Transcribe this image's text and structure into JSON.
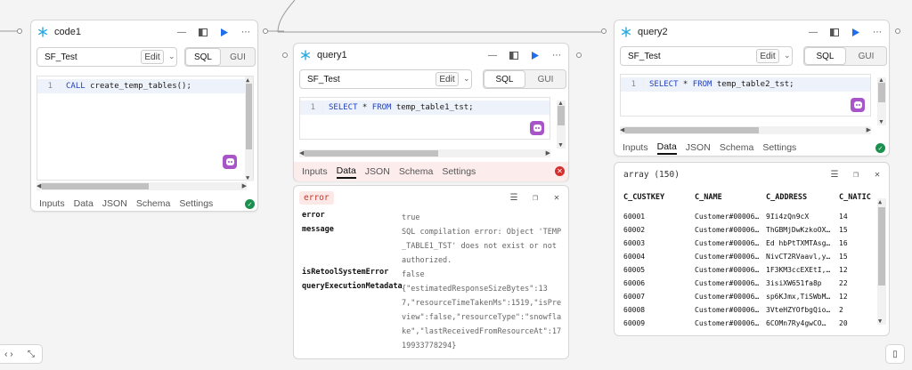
{
  "colors": {
    "accent": "#1f6feb",
    "success": "#1a8f4e",
    "error": "#d32f2f",
    "ai": "#a855c8",
    "errorBg": "#fde8e8"
  },
  "code1": {
    "title": "code1",
    "resource": "SF_Test",
    "edit_label": "Edit",
    "mode_sql": "SQL",
    "mode_gui": "GUI",
    "line_no": "1",
    "code_kw": "CALL",
    "code_rest": " create_temp_tables();",
    "tabs": [
      "Inputs",
      "Data",
      "JSON",
      "Schema",
      "Settings"
    ]
  },
  "query1": {
    "title": "query1",
    "resource": "SF_Test",
    "edit_label": "Edit",
    "mode_sql": "SQL",
    "mode_gui": "GUI",
    "line_no": "1",
    "code_kw1": "SELECT",
    "code_mid": " * ",
    "code_kw2": "FROM",
    "code_rest": " temp_table1_tst;",
    "tabs": [
      "Inputs",
      "Data",
      "JSON",
      "Schema",
      "Settings"
    ]
  },
  "query2": {
    "title": "query2",
    "resource": "SF_Test",
    "edit_label": "Edit",
    "mode_sql": "SQL",
    "mode_gui": "GUI",
    "line_no": "1",
    "code_kw1": "SELECT",
    "code_mid": " * ",
    "code_kw2": "FROM",
    "code_rest": " temp_table2_tst;",
    "tabs": [
      "Inputs",
      "Data",
      "JSON",
      "Schema",
      "Settings"
    ]
  },
  "error_result": {
    "badge": "error",
    "rows": [
      {
        "key": "error",
        "value": "true"
      },
      {
        "key": "message",
        "value": "SQL compilation error: Object 'TEMP_TABLE1_TST' does not exist or not authorized."
      },
      {
        "key": "isRetoolSystemError",
        "value": "false"
      },
      {
        "key": "queryExecutionMetadata",
        "value": "{\"estimatedResponseSizeBytes\":137,\"resourceTimeTakenMs\":1519,\"isPreview\":false,\"resourceType\":\"snowflake\",\"lastReceivedFromResourceAt\":1719933778294}"
      }
    ]
  },
  "array_result": {
    "label": "array (150)",
    "columns": [
      "C_CUSTKEY",
      "C_NAME",
      "C_ADDRESS",
      "C_NATIC"
    ],
    "rows": [
      [
        "60001",
        "Customer#00006…",
        "9Ii4zQn9cX",
        "14"
      ],
      [
        "60002",
        "Customer#00006…",
        "ThGBMjDwKzkoOX…",
        "15"
      ],
      [
        "60003",
        "Customer#00006…",
        "Ed hbPtTXMTAsg…",
        "16"
      ],
      [
        "60004",
        "Customer#00006…",
        "NivCT2RVaavl,y…",
        "15"
      ],
      [
        "60005",
        "Customer#00006…",
        "1F3KM3ccEXEtI,…",
        "12"
      ],
      [
        "60006",
        "Customer#00006…",
        "3isiXW651fa8p",
        "22"
      ],
      [
        "60007",
        "Customer#00006…",
        "sp6KJmx,TiSWbM…",
        "12"
      ],
      [
        "60008",
        "Customer#00006…",
        "3VteHZYOfbgQio…",
        "2"
      ],
      [
        "60009",
        "Customer#00006…",
        "6COMn7Ry4gwCO…",
        "20"
      ]
    ]
  },
  "bottom": {
    "left_a": "‹ ›",
    "left_b": "⤡",
    "right": "▯"
  }
}
